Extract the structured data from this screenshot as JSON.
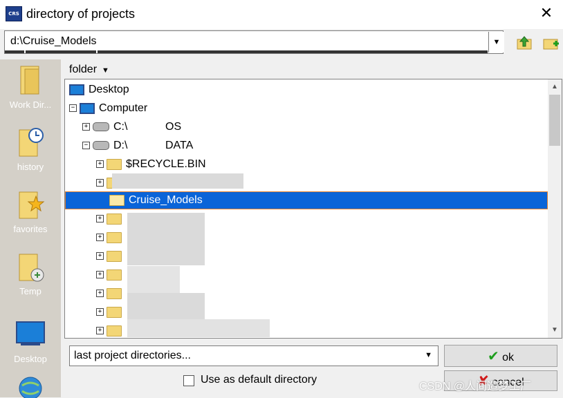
{
  "window": {
    "title": "directory of projects",
    "close_glyph": "✕"
  },
  "pathbar": {
    "value": "d:\\Cruise_Models"
  },
  "sidebar": {
    "items": [
      {
        "label": "Work Dir...",
        "icon": "work-dir-folder-icon"
      },
      {
        "label": "history",
        "icon": "history-folder-icon"
      },
      {
        "label": "favorites",
        "icon": "favorites-folder-icon"
      },
      {
        "label": "Temp",
        "icon": "temp-folder-icon"
      },
      {
        "label": "Desktop",
        "icon": "desktop-icon"
      }
    ]
  },
  "folder_header": {
    "label": "folder"
  },
  "tree": {
    "desktop": "Desktop",
    "computer": "Computer",
    "drive_c": {
      "name": "C:\\",
      "label": "OS"
    },
    "drive_d": {
      "name": "D:\\",
      "label": "DATA"
    },
    "recycle": "$RECYCLE.BIN",
    "selected": "Cruise_Models"
  },
  "combo": {
    "value": "last project directories..."
  },
  "buttons": {
    "ok": "ok",
    "cancel": "cancel"
  },
  "checkbox": {
    "label": "Use as default directory",
    "checked": false
  },
  "watermark": "CSDN @人间造梦工厂",
  "colors": {
    "selection": "#0a64d8",
    "selection_border": "#e08030",
    "ok_check": "#1e9e1e",
    "cancel_x": "#d01a1a"
  }
}
